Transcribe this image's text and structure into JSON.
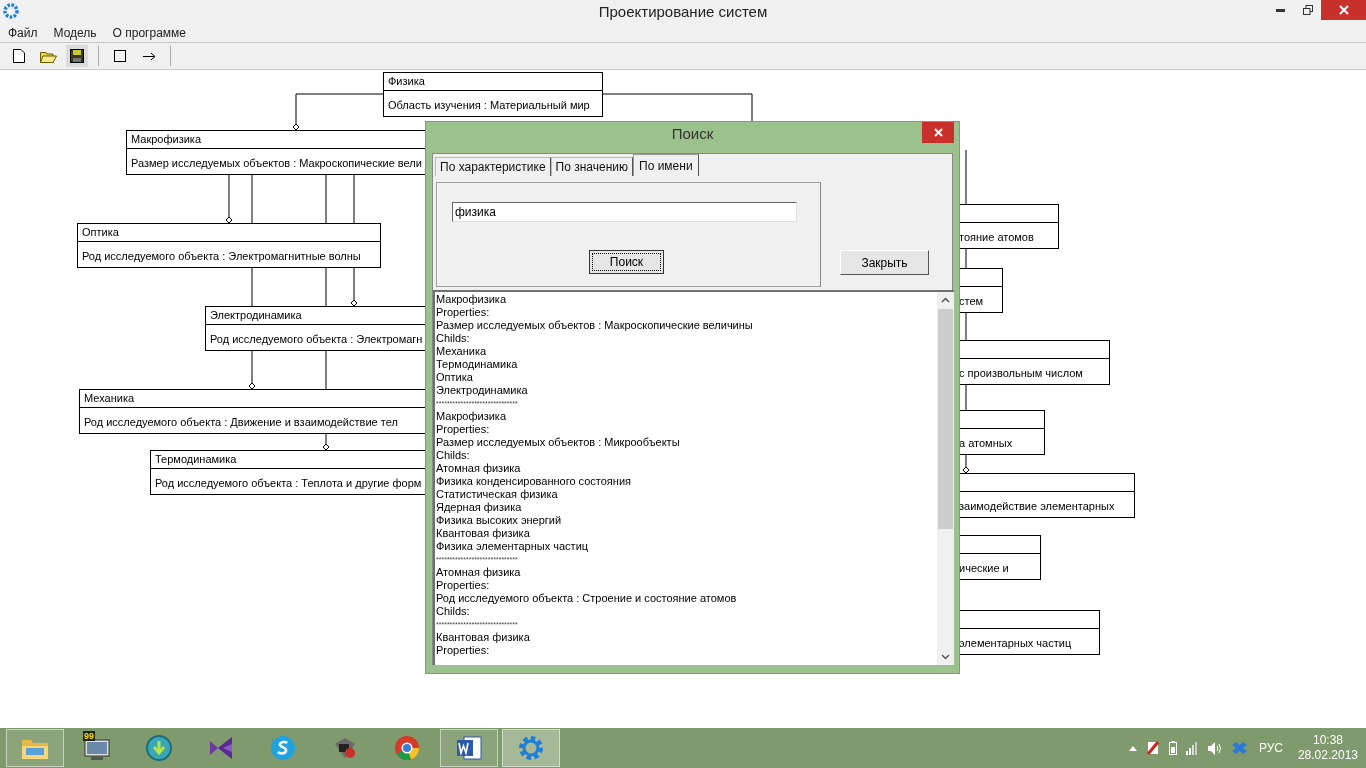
{
  "window": {
    "title": "Проектирование систем"
  },
  "menu": [
    "Файл",
    "Модель",
    "О программе"
  ],
  "diagram": {
    "nodes": [
      {
        "title": "Физика",
        "property": "Область изучения : Материальный мир"
      },
      {
        "title": "Макрофизика",
        "property": "Размер исследуемых объектов : Макроскопические вели"
      },
      {
        "title": "Оптика",
        "property": "Род исследуемого объекта : Электромагнитные волны"
      },
      {
        "title": "Электродинамика",
        "property": "Род исследуемого объекта : Электромагн"
      },
      {
        "title": "Механика",
        "property": "Род исследуемого объекта : Движение и взаимодействие тел"
      },
      {
        "title": "Термодинамика",
        "property": "Род исследуемого объекта : Теплота и другие форм"
      },
      {
        "property": "тояние атомов"
      },
      {
        "property": "стем"
      },
      {
        "property": "с произвольным числом"
      },
      {
        "property": "а атомных"
      },
      {
        "property": "заимодействие элементарных"
      },
      {
        "property": "ические и"
      },
      {
        "property": "элементарных частиц"
      }
    ]
  },
  "dialog": {
    "title": "Поиск",
    "tabs": [
      {
        "label": "По характеристике",
        "selected": false
      },
      {
        "label": "По значению",
        "selected": false
      },
      {
        "label": "По имени",
        "selected": true
      }
    ],
    "search_field": {
      "value": "физика"
    },
    "search_button": "Поиск",
    "close_button": "Закрыть",
    "results": [
      {
        "kind": "text",
        "text": "Макрофизика"
      },
      {
        "kind": "text",
        "text": "Properties:"
      },
      {
        "kind": "text",
        "text": "Размер исследуемых объектов : Макроскопические величины"
      },
      {
        "kind": "text",
        "text": "Childs:"
      },
      {
        "kind": "text",
        "text": "Механика"
      },
      {
        "kind": "text",
        "text": "Термодинамика"
      },
      {
        "kind": "text",
        "text": "Оптика"
      },
      {
        "kind": "text",
        "text": "Электродинамика"
      },
      {
        "kind": "separator",
        "text": "******************************"
      },
      {
        "kind": "text",
        "text": "Макрофизика"
      },
      {
        "kind": "text",
        "text": "Properties:"
      },
      {
        "kind": "text",
        "text": "Размер исследуемых объектов : Микрообъекты"
      },
      {
        "kind": "text",
        "text": "Childs:"
      },
      {
        "kind": "text",
        "text": "Атомная физика"
      },
      {
        "kind": "text",
        "text": "Физика конденсированного состояния"
      },
      {
        "kind": "text",
        "text": "Статистическая физика"
      },
      {
        "kind": "text",
        "text": "Ядерная физика"
      },
      {
        "kind": "text",
        "text": "Физика высоких энергий"
      },
      {
        "kind": "text",
        "text": "Квантовая физика"
      },
      {
        "kind": "text",
        "text": "Физика элементарных частиц"
      },
      {
        "kind": "separator",
        "text": "******************************"
      },
      {
        "kind": "text",
        "text": "Атомная физика"
      },
      {
        "kind": "text",
        "text": "Properties:"
      },
      {
        "kind": "text",
        "text": "Род исследуемого объекта : Строение и состояние атомов"
      },
      {
        "kind": "text",
        "text": "Childs:"
      },
      {
        "kind": "separator",
        "text": "******************************"
      },
      {
        "kind": "text",
        "text": "Квантовая физика"
      },
      {
        "kind": "text",
        "text": "Properties:"
      }
    ]
  },
  "taskbar": {
    "apps": [
      {
        "kind": "folder",
        "open": true,
        "selected": false
      },
      {
        "kind": "monitor",
        "open": false,
        "selected": false
      },
      {
        "kind": "download",
        "open": false,
        "selected": false
      },
      {
        "kind": "ribbon",
        "open": false,
        "selected": false
      },
      {
        "kind": "chat",
        "open": false,
        "selected": false
      },
      {
        "kind": "terminal",
        "open": false,
        "selected": false
      },
      {
        "kind": "browser",
        "open": false,
        "selected": false
      },
      {
        "kind": "document",
        "open": true,
        "selected": false
      },
      {
        "kind": "gear",
        "open": true,
        "selected": true
      }
    ],
    "badge": "99",
    "language": "РУС",
    "time": "10:38",
    "date": "28.02.2013"
  }
}
